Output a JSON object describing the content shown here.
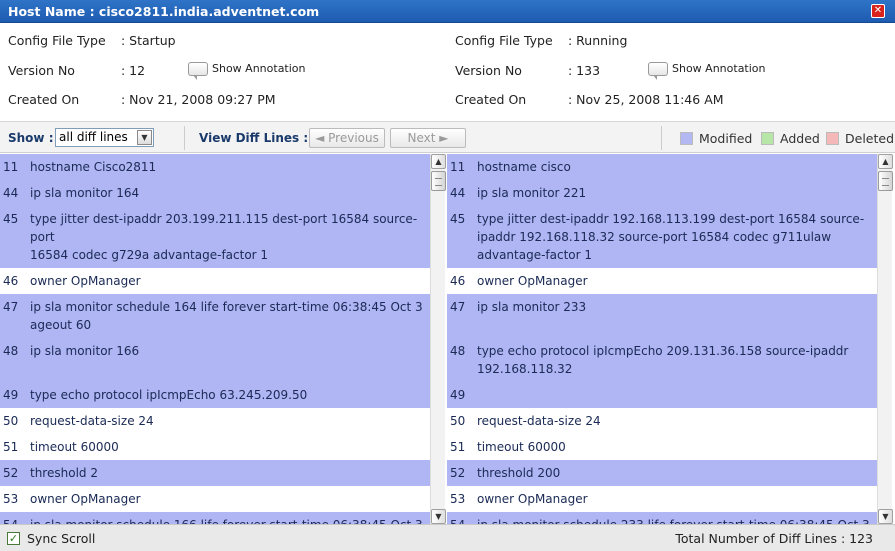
{
  "window": {
    "title": "Host Name : cisco2811.india.adventnet.com",
    "close_glyph": "✕"
  },
  "left_info": {
    "config_type_label": "Config File Type",
    "config_type_value": ": Startup",
    "version_label": "Version No",
    "version_value": ": 12",
    "created_label": "Created On",
    "created_value": ": Nov 21, 2008 09:27 PM",
    "annotation": "Show Annotation"
  },
  "right_info": {
    "config_type_label": "Config File Type",
    "config_type_value": ": Running",
    "version_label": "Version No",
    "version_value": ": 133",
    "created_label": "Created On",
    "created_value": ": Nov 25, 2008 11:46 AM",
    "annotation": "Show Annotation"
  },
  "toolbar": {
    "show_label": "Show :",
    "show_selected": "all diff lines",
    "view_diff_label": "View Diff Lines :",
    "previous": "◄ Previous",
    "next": "Next ►"
  },
  "legend": [
    {
      "label": "Modified",
      "color": "#b3b7f2"
    },
    {
      "label": "Added",
      "color": "#b8e6a8"
    },
    {
      "label": "Deleted",
      "color": "#f4b8b8"
    }
  ],
  "left_lines": [
    {
      "n": "11",
      "t": "hostname Cisco2811",
      "modified": true
    },
    {
      "n": "44",
      "t": "ip sla monitor 164",
      "modified": true
    },
    {
      "n": "45",
      "t": "type jitter dest-ipaddr 203.199.211.115 dest-port 16584 source-port",
      "t2": "16584 codec g729a advantage-factor 1",
      "modified": true
    },
    {
      "n": "46",
      "t": "owner OpManager",
      "modified": false
    },
    {
      "n": "47",
      "t": "ip sla monitor schedule 164 life forever start-time 06:38:45 Oct 3",
      "t2": "ageout 60",
      "modified": true
    },
    {
      "n": "48",
      "t": "ip sla monitor 166",
      "modified": true
    },
    {
      "n": "49",
      "t": "type echo protocol ipIcmpEcho 63.245.209.50",
      "modified": true
    },
    {
      "n": "50",
      "t": "request-data-size 24",
      "modified": false
    },
    {
      "n": "51",
      "t": "timeout 60000",
      "modified": false
    },
    {
      "n": "52",
      "t": "threshold 2",
      "modified": true
    },
    {
      "n": "53",
      "t": "owner OpManager",
      "modified": false
    },
    {
      "n": "54",
      "t": "ip sla monitor schedule 166 life forever start-time 06:38:45 Oct 3",
      "modified": true
    }
  ],
  "right_lines": [
    {
      "n": "11",
      "t": "hostname cisco",
      "modified": true
    },
    {
      "n": "44",
      "t": "ip sla monitor 221",
      "modified": true
    },
    {
      "n": "45",
      "t": "type jitter dest-ipaddr 192.168.113.199 dest-port 16584 source-",
      "t2": "ipaddr 192.168.118.32 source-port 16584 codec g711ulaw",
      "t3": "advantage-factor 1",
      "modified": true
    },
    {
      "n": "46",
      "t": "owner OpManager",
      "modified": false
    },
    {
      "n": "47",
      "t": "ip sla monitor 233",
      "modified": true
    },
    {
      "n": "48",
      "t": "type echo protocol ipIcmpEcho 209.131.36.158 source-ipaddr",
      "t2": "192.168.118.32",
      "modified": true
    },
    {
      "n": "49",
      "t": "",
      "modified": true
    },
    {
      "n": "50",
      "t": "request-data-size 24",
      "modified": false
    },
    {
      "n": "51",
      "t": "timeout 60000",
      "modified": false
    },
    {
      "n": "52",
      "t": "threshold 200",
      "modified": true
    },
    {
      "n": "53",
      "t": "owner OpManager",
      "modified": false
    },
    {
      "n": "54",
      "t": "ip sla monitor schedule 233 life forever start-time 06:38:45 Oct 3",
      "modified": true
    }
  ],
  "status": {
    "sync_scroll": "Sync Scroll",
    "total_label": "Total Number of Diff Lines : 123"
  }
}
